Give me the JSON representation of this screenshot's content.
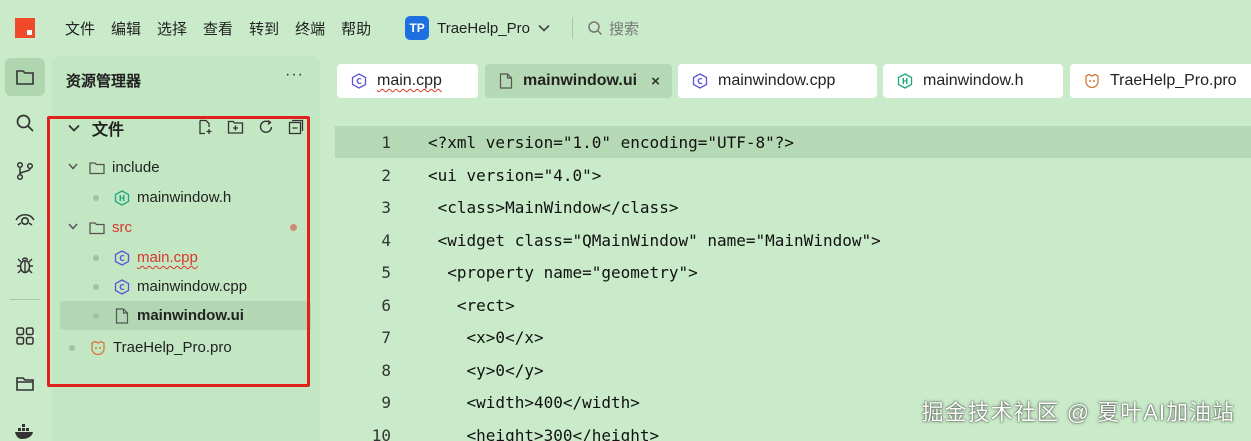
{
  "menu": [
    "文件",
    "编辑",
    "选择",
    "查看",
    "转到",
    "终端",
    "帮助"
  ],
  "project": {
    "badge": "TP",
    "name": "TraeHelp_Pro"
  },
  "search": {
    "label": "搜索"
  },
  "explorer": {
    "title": "资源管理器",
    "more": "···",
    "section_title": "文件",
    "tree": [
      {
        "label": "include",
        "kind": "folder"
      },
      {
        "label": "mainwindow.h",
        "kind": "h"
      },
      {
        "label": "src",
        "kind": "folder"
      },
      {
        "label": "main.cpp",
        "kind": "cpp"
      },
      {
        "label": "mainwindow.cpp",
        "kind": "cpp"
      },
      {
        "label": "mainwindow.ui",
        "kind": "ui"
      },
      {
        "label": "TraeHelp_Pro.pro",
        "kind": "pro"
      }
    ]
  },
  "tabs": [
    {
      "label": "main.cpp",
      "active": false
    },
    {
      "label": "mainwindow.ui",
      "active": true,
      "close": "×"
    },
    {
      "label": "mainwindow.cpp",
      "active": false
    },
    {
      "label": "mainwindow.h",
      "active": false
    },
    {
      "label": "TraeHelp_Pro.pro",
      "active": false
    }
  ],
  "code": [
    {
      "n": "1",
      "text": "<?xml version=\"1.0\" encoding=\"UTF-8\"?>"
    },
    {
      "n": "2",
      "text": "<ui version=\"4.0\">"
    },
    {
      "n": "3",
      "text": " <class>MainWindow</class>"
    },
    {
      "n": "4",
      "text": " <widget class=\"QMainWindow\" name=\"MainWindow\">"
    },
    {
      "n": "5",
      "text": "  <property name=\"geometry\">"
    },
    {
      "n": "6",
      "text": "   <rect>"
    },
    {
      "n": "7",
      "text": "    <x>0</x>"
    },
    {
      "n": "8",
      "text": "    <y>0</y>"
    },
    {
      "n": "9",
      "text": "    <width>400</width>"
    },
    {
      "n": "10",
      "text": "    <height>300</height>"
    }
  ],
  "watermark": "掘金技术社区 @ 夏叶AI加油站",
  "colors": {
    "background": "#c9ebc9",
    "accent": "#1e6fe0",
    "highlight_box": "#e0221a",
    "error": "#d8382f"
  }
}
